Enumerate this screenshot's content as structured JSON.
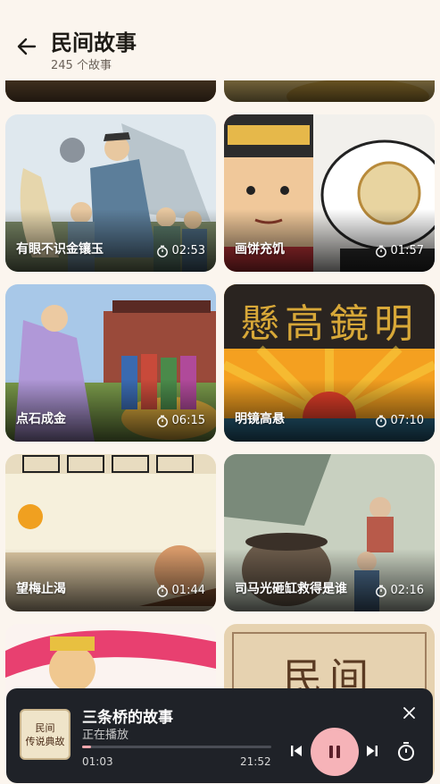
{
  "header": {
    "title": "民间故事",
    "subtitle": "245 个故事"
  },
  "stories": [
    {
      "title": "有眼不识金镶玉",
      "duration": "02:53"
    },
    {
      "title": "画饼充饥",
      "duration": "01:57"
    },
    {
      "title": "点石成金",
      "duration": "06:15"
    },
    {
      "title": "明镜高悬",
      "duration": "07:10"
    },
    {
      "title": "望梅止渴",
      "duration": "01:44"
    },
    {
      "title": "司马光砸缸救得是谁",
      "duration": "02:16"
    }
  ],
  "artwork_text": {
    "mirror_plaque": "懸高鏡明",
    "last_card_text": "民间"
  },
  "player": {
    "cover_line1": "民间",
    "cover_line2": "传说典故",
    "title": "三条桥的故事",
    "status": "正在播放",
    "current_time": "01:03",
    "total_time": "21:52",
    "progress": 0.048
  },
  "colors": {
    "accent": "#f6b3b8",
    "player_bg": "#1f2228",
    "page_bg": "#fbf5ee"
  },
  "icons": [
    "back-arrow-icon",
    "timer-icon",
    "skip-previous-icon",
    "pause-icon",
    "skip-next-icon",
    "sleep-timer-icon",
    "close-icon"
  ]
}
